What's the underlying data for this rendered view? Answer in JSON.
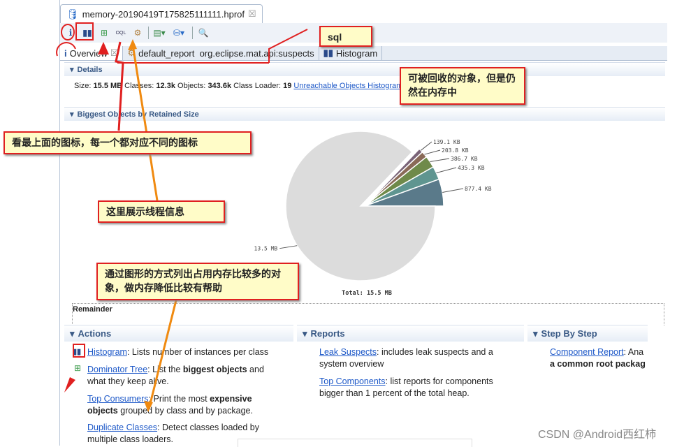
{
  "editor": {
    "file_tab": "memory-20190419T175825111111.hprof",
    "close": "☒"
  },
  "toolbar": {
    "icons": [
      "info-icon",
      "histogram-icon",
      "dominator-tree-icon",
      "oql-icon",
      "thread-gear-icon",
      "query-browser-icon",
      "heap-dump-icon",
      "search-icon"
    ]
  },
  "tabs": [
    {
      "label": "Overview",
      "icon": "info-icon"
    },
    {
      "label": "default_report  org.eclipse.mat.api:suspects",
      "icon": "gear-icon"
    },
    {
      "label": "Histogram",
      "icon": "histogram-icon"
    }
  ],
  "details": {
    "header": "Details",
    "size_label": "Size:",
    "size": "15.5 MB",
    "classes_label": "Classes:",
    "classes": "12.3k",
    "objects_label": "Objects:",
    "objects": "343.6k",
    "loader_label": "Class Loader:",
    "loader": "19",
    "link": "Unreachable Objects Histogram"
  },
  "biggest": {
    "header": "Biggest Objects by Retained Size",
    "total": "Total: 15.5 MB",
    "remainder": "Remainder"
  },
  "chart_data": {
    "type": "pie",
    "total": "Total: 15.5 MB",
    "slices": [
      {
        "label": "877.4 KB",
        "value": 877.4,
        "color": "#5a7a8a"
      },
      {
        "label": "435.3 KB",
        "value": 435.3,
        "color": "#5f9590"
      },
      {
        "label": "386.7 KB",
        "value": 386.7,
        "color": "#6f8a4a"
      },
      {
        "label": "203.8 KB",
        "value": 203.8,
        "color": "#8a6a58"
      },
      {
        "label": "139.1 KB",
        "value": 139.1,
        "color": "#7a6478"
      },
      {
        "label": "13.5 MB",
        "value": 13824,
        "color": "#dcdcdc"
      }
    ]
  },
  "actions": {
    "header": "Actions",
    "items": [
      {
        "link": "Histogram",
        "text": ": Lists number of instances per class"
      },
      {
        "link": "Dominator Tree",
        "text1": ": List the ",
        "bold": "biggest objects",
        "text2": " and what they keep alive."
      },
      {
        "link": "Top Consumers",
        "text1": ": Print the most ",
        "bold": "expensive objects",
        "text2": " grouped by class and by package."
      },
      {
        "link": "Duplicate Classes",
        "text": ": Detect classes loaded by multiple class loaders."
      }
    ]
  },
  "reports": {
    "header": "Reports",
    "items": [
      {
        "link": "Leak Suspects",
        "text": ": includes leak suspects and a system overview"
      },
      {
        "link": "Top Components",
        "text": ": list reports for components bigger than 1 percent of the total heap."
      }
    ]
  },
  "steps": {
    "header": "Step By Step",
    "link": "Component Report",
    "text": ": Ana",
    "bold": "a common root packag"
  },
  "annotations": {
    "sql": "sql",
    "unreachable": "可被回收的对象，但是仍然在内存中",
    "icons": "看最上面的图标，每一个都对应不同的图标",
    "threads": "这里展示线程信息",
    "chart": "通过图形的方式列出占用内存比较多的对象，做内存降低比较有帮助"
  },
  "watermark": "CSDN @Android西红柿"
}
